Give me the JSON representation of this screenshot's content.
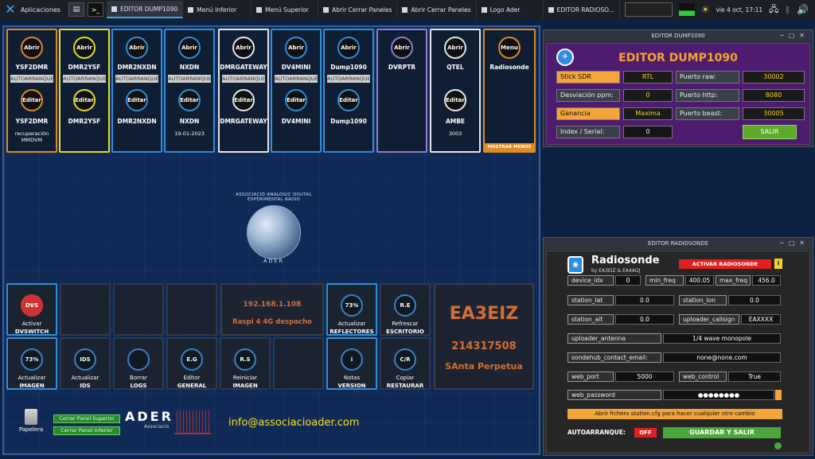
{
  "taskbar": {
    "apps_label": "Aplicaciones",
    "tasks": [
      "EDITOR DUMP1090",
      "Menú Inferior",
      "Menú Superior",
      "Abrir Cerrar Paneles",
      "Abrir Cerrar Paneles",
      "Logo Ader",
      "EDITOR RADIOSO..."
    ],
    "clock": "vie  4 oct, 17:11"
  },
  "tiles": [
    {
      "top_btn": "Abrir",
      "name1": "YSF2DMR",
      "auto": "AUTOARRANQUE",
      "bottom_btn": "Editar",
      "name2": "YSF2DMR",
      "extra": "recuperación MMDVM",
      "border": "#e08a22"
    },
    {
      "top_btn": "Abrir",
      "name1": "DMR2YSF",
      "auto": "AUTOARRANQUE",
      "bottom_btn": "Editar",
      "name2": "DMR2YSF",
      "extra": "",
      "border": "#e3dc2a"
    },
    {
      "top_btn": "Abrir",
      "name1": "DMR2NXDN",
      "auto": "AUTOARRANQUE",
      "bottom_btn": "Editar",
      "name2": "DMR2NXDN",
      "extra": "",
      "border": "#2f8fd8"
    },
    {
      "top_btn": "Abrir",
      "name1": "NXDN",
      "auto": "AUTOARRANQUE",
      "bottom_btn": "Editar",
      "name2": "NXDN",
      "extra": "19-01-2023",
      "border": "#2f8fd8"
    },
    {
      "top_btn": "Abrir",
      "name1": "DMRGATEWAY",
      "auto": "AUTOARRANQUE",
      "bottom_btn": "Editar",
      "name2": "DMRGATEWAY",
      "extra": "",
      "border": "#e6e6e6"
    },
    {
      "top_btn": "Abrir",
      "name1": "DV4MINI",
      "auto": "AUTOARRANQUE",
      "bottom_btn": "Editar",
      "name2": "DV4MINI",
      "extra": "",
      "border": "#2f8fd8"
    },
    {
      "top_btn": "Abrir",
      "name1": "Dump1090",
      "auto": "AUTOARRANQUE",
      "bottom_btn": "Editar",
      "name2": "Dump1090",
      "extra": "",
      "border": "#2f8fd8"
    },
    {
      "top_btn": "Abrir",
      "name1": "DVRPTR",
      "auto": "",
      "bottom_btn": "",
      "name2": "",
      "extra": "",
      "border": "#8a7fd0"
    },
    {
      "top_btn": "Abrir",
      "name1": "QTEL",
      "auto": "",
      "bottom_btn": "Editar",
      "name2": "AMBE",
      "extra": "3003",
      "border": "#e6e6e6"
    },
    {
      "top_btn": "Menu",
      "name1": "Radiosonde",
      "auto": "",
      "bottom_btn": "",
      "name2": "",
      "extra": "",
      "border": "#e08a22",
      "footer": "MOSTRAR MENOS"
    }
  ],
  "logo_ring_text": "ASSOCIACIÓ ANALÒGIC DIGITAL EXPERIMENTAL RADIO",
  "logo_name": "ADER",
  "bottom": {
    "row1": [
      {
        "circle": "DVS",
        "label1": "Activar",
        "label2": "DVSWITCH",
        "border": "#2f8fd8"
      },
      {
        "circle": "",
        "label1": "",
        "label2": "",
        "border": "#2e3a4e"
      },
      {
        "circle": "",
        "label1": "",
        "label2": "",
        "border": "#2e3a4e"
      },
      {
        "circle": "",
        "label1": "",
        "label2": "",
        "border": "#2e3a4e"
      }
    ],
    "ip": "192.168.1.108",
    "host": "Raspi 4 4G despacho",
    "row1b": [
      {
        "circle": "73%",
        "label1": "Actualizar",
        "label2": "REFLECTORES",
        "border": "#2f8fd8"
      },
      {
        "circle": "R.E",
        "label1": "Refrescar",
        "label2": "ESCRITORIO",
        "border": "#2e3a4e"
      }
    ],
    "row2": [
      {
        "circle": "73%",
        "label1": "Actualizar",
        "label2": "IMAGEN",
        "border": "#2f8fd8"
      },
      {
        "circle": "IDS",
        "label1": "Actualizar",
        "label2": "IDS",
        "border": "#2e3a4e"
      },
      {
        "circle": "",
        "label1": "Borrar",
        "label2": "LOGS",
        "border": "#2e3a4e"
      },
      {
        "circle": "E.G",
        "label1": "Editor",
        "label2": "GENERAL",
        "border": "#2e3a4e"
      },
      {
        "circle": "R.S",
        "label1": "Reiniciar",
        "label2": "IMAGEN",
        "border": "#2e3a4e"
      },
      {
        "circle": "",
        "label1": "",
        "label2": "",
        "border": "#2e3a4e"
      },
      {
        "circle": "i",
        "label1": "Notas",
        "label2": "VERSION",
        "border": "#2f8fd8"
      },
      {
        "circle": "C/R",
        "label1": "Copiar",
        "label2": "RESTAURAR",
        "border": "#2e3a4e"
      }
    ],
    "callsign": "EA3EIZ",
    "dmr_id": "214317508",
    "location": "SAnta Perpetua"
  },
  "footer": {
    "trash": "Papelera",
    "btn_top": "Cerrar Panel Superior",
    "btn_bottom": "Cerrar Panel Inferior",
    "ader": "ADER",
    "ader_sub": "Associació",
    "email": "info@associacioader.com"
  },
  "dump1090": {
    "window_title": "EDITOR DUMP1090",
    "heading": "EDITOR DUMP1090",
    "stick_label": "Stick SDR",
    "stick_value": "RTL",
    "raw_label": "Puerto raw:",
    "raw_value": "30002",
    "ppm_label": "Desviación ppm:",
    "ppm_value": "0",
    "http_label": "Puerto http:",
    "http_value": "8080",
    "gain_label": "Ganancia",
    "gain_value": "Maxima",
    "beast_label": "Puerto beast:",
    "beast_value": "30005",
    "index_label": "Index / Serial:",
    "index_value": "0",
    "exit": "SALIR"
  },
  "radiosonde": {
    "window_title": "EDITOR RADIOSONDE",
    "heading": "Radiosonde",
    "sub": "by EA3EIZ & EA4AOJ",
    "activate": "ACTIVAR RADIOSONDE",
    "info": "i",
    "fields": {
      "device_idx": {
        "label": "device_idx",
        "value": "0"
      },
      "min_freq": {
        "label": "min_freq",
        "value": "400.05"
      },
      "max_freq": {
        "label": "max_freq",
        "value": "456.0"
      },
      "station_lat": {
        "label": "station_lat",
        "value": "0.0"
      },
      "station_lon": {
        "label": "station_lon",
        "value": "0.0"
      },
      "station_alt": {
        "label": "station_alt",
        "value": "0.0"
      },
      "uploader_callsign": {
        "label": "uploader_callsign",
        "value": "EAXXXX"
      },
      "uploader_antenna": {
        "label": "uploader_antenna",
        "value": "1/4 wave monopole"
      },
      "contact_email": {
        "label": "sondehub_contact_email:",
        "value": "none@none.com"
      },
      "web_port": {
        "label": "web_port",
        "value": "5000"
      },
      "web_control": {
        "label": "web_control",
        "value": "True"
      },
      "web_password": {
        "label": "web_password",
        "value": "●●●●●●●●"
      }
    },
    "open_cfg": "Abrir fichero station.cfg para hacer cualquier otro cambio",
    "autostart_label": "AUTOARRANQUE:",
    "autostart_value": "OFF",
    "save": "GUARDAR Y SALIR"
  }
}
